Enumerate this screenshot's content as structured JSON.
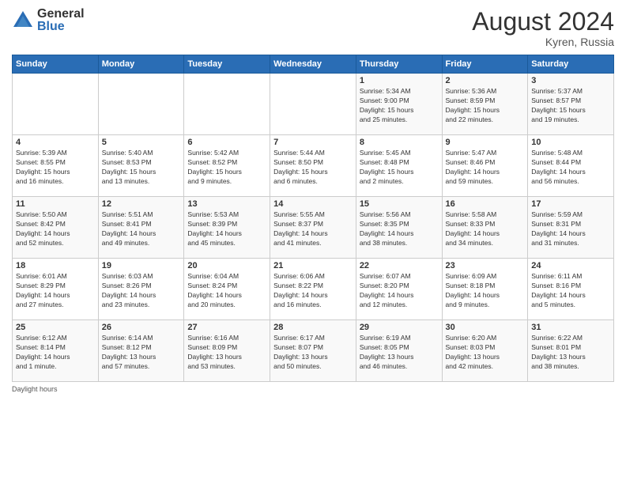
{
  "logo": {
    "general": "General",
    "blue": "Blue"
  },
  "title": {
    "month_year": "August 2024",
    "location": "Kyren, Russia"
  },
  "days_of_week": [
    "Sunday",
    "Monday",
    "Tuesday",
    "Wednesday",
    "Thursday",
    "Friday",
    "Saturday"
  ],
  "weeks": [
    [
      {
        "day": "",
        "info": ""
      },
      {
        "day": "",
        "info": ""
      },
      {
        "day": "",
        "info": ""
      },
      {
        "day": "",
        "info": ""
      },
      {
        "day": "1",
        "info": "Sunrise: 5:34 AM\nSunset: 9:00 PM\nDaylight: 15 hours\nand 25 minutes."
      },
      {
        "day": "2",
        "info": "Sunrise: 5:36 AM\nSunset: 8:59 PM\nDaylight: 15 hours\nand 22 minutes."
      },
      {
        "day": "3",
        "info": "Sunrise: 5:37 AM\nSunset: 8:57 PM\nDaylight: 15 hours\nand 19 minutes."
      }
    ],
    [
      {
        "day": "4",
        "info": "Sunrise: 5:39 AM\nSunset: 8:55 PM\nDaylight: 15 hours\nand 16 minutes."
      },
      {
        "day": "5",
        "info": "Sunrise: 5:40 AM\nSunset: 8:53 PM\nDaylight: 15 hours\nand 13 minutes."
      },
      {
        "day": "6",
        "info": "Sunrise: 5:42 AM\nSunset: 8:52 PM\nDaylight: 15 hours\nand 9 minutes."
      },
      {
        "day": "7",
        "info": "Sunrise: 5:44 AM\nSunset: 8:50 PM\nDaylight: 15 hours\nand 6 minutes."
      },
      {
        "day": "8",
        "info": "Sunrise: 5:45 AM\nSunset: 8:48 PM\nDaylight: 15 hours\nand 2 minutes."
      },
      {
        "day": "9",
        "info": "Sunrise: 5:47 AM\nSunset: 8:46 PM\nDaylight: 14 hours\nand 59 minutes."
      },
      {
        "day": "10",
        "info": "Sunrise: 5:48 AM\nSunset: 8:44 PM\nDaylight: 14 hours\nand 56 minutes."
      }
    ],
    [
      {
        "day": "11",
        "info": "Sunrise: 5:50 AM\nSunset: 8:42 PM\nDaylight: 14 hours\nand 52 minutes."
      },
      {
        "day": "12",
        "info": "Sunrise: 5:51 AM\nSunset: 8:41 PM\nDaylight: 14 hours\nand 49 minutes."
      },
      {
        "day": "13",
        "info": "Sunrise: 5:53 AM\nSunset: 8:39 PM\nDaylight: 14 hours\nand 45 minutes."
      },
      {
        "day": "14",
        "info": "Sunrise: 5:55 AM\nSunset: 8:37 PM\nDaylight: 14 hours\nand 41 minutes."
      },
      {
        "day": "15",
        "info": "Sunrise: 5:56 AM\nSunset: 8:35 PM\nDaylight: 14 hours\nand 38 minutes."
      },
      {
        "day": "16",
        "info": "Sunrise: 5:58 AM\nSunset: 8:33 PM\nDaylight: 14 hours\nand 34 minutes."
      },
      {
        "day": "17",
        "info": "Sunrise: 5:59 AM\nSunset: 8:31 PM\nDaylight: 14 hours\nand 31 minutes."
      }
    ],
    [
      {
        "day": "18",
        "info": "Sunrise: 6:01 AM\nSunset: 8:29 PM\nDaylight: 14 hours\nand 27 minutes."
      },
      {
        "day": "19",
        "info": "Sunrise: 6:03 AM\nSunset: 8:26 PM\nDaylight: 14 hours\nand 23 minutes."
      },
      {
        "day": "20",
        "info": "Sunrise: 6:04 AM\nSunset: 8:24 PM\nDaylight: 14 hours\nand 20 minutes."
      },
      {
        "day": "21",
        "info": "Sunrise: 6:06 AM\nSunset: 8:22 PM\nDaylight: 14 hours\nand 16 minutes."
      },
      {
        "day": "22",
        "info": "Sunrise: 6:07 AM\nSunset: 8:20 PM\nDaylight: 14 hours\nand 12 minutes."
      },
      {
        "day": "23",
        "info": "Sunrise: 6:09 AM\nSunset: 8:18 PM\nDaylight: 14 hours\nand 9 minutes."
      },
      {
        "day": "24",
        "info": "Sunrise: 6:11 AM\nSunset: 8:16 PM\nDaylight: 14 hours\nand 5 minutes."
      }
    ],
    [
      {
        "day": "25",
        "info": "Sunrise: 6:12 AM\nSunset: 8:14 PM\nDaylight: 14 hours\nand 1 minute."
      },
      {
        "day": "26",
        "info": "Sunrise: 6:14 AM\nSunset: 8:12 PM\nDaylight: 13 hours\nand 57 minutes."
      },
      {
        "day": "27",
        "info": "Sunrise: 6:16 AM\nSunset: 8:09 PM\nDaylight: 13 hours\nand 53 minutes."
      },
      {
        "day": "28",
        "info": "Sunrise: 6:17 AM\nSunset: 8:07 PM\nDaylight: 13 hours\nand 50 minutes."
      },
      {
        "day": "29",
        "info": "Sunrise: 6:19 AM\nSunset: 8:05 PM\nDaylight: 13 hours\nand 46 minutes."
      },
      {
        "day": "30",
        "info": "Sunrise: 6:20 AM\nSunset: 8:03 PM\nDaylight: 13 hours\nand 42 minutes."
      },
      {
        "day": "31",
        "info": "Sunrise: 6:22 AM\nSunset: 8:01 PM\nDaylight: 13 hours\nand 38 minutes."
      }
    ]
  ],
  "footer": {
    "note": "Daylight hours"
  }
}
